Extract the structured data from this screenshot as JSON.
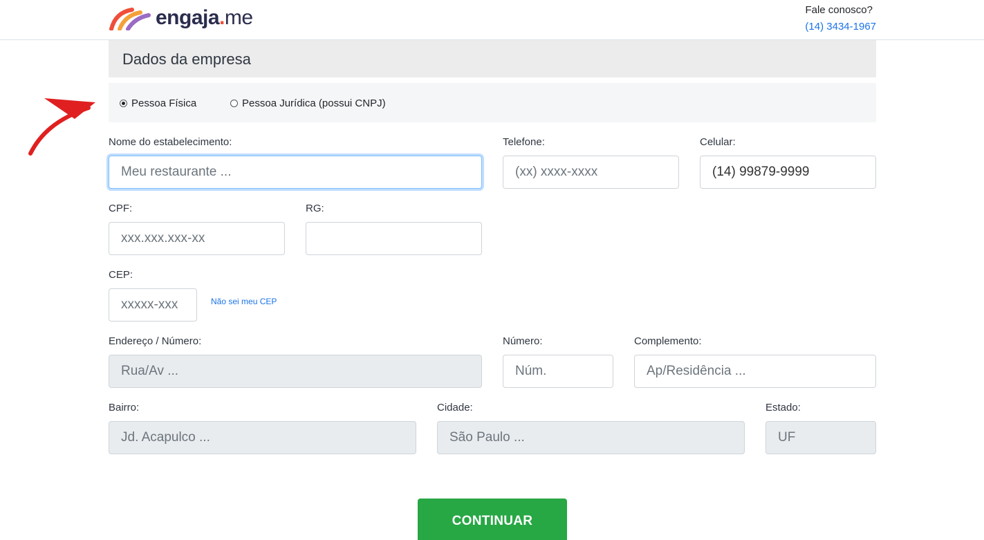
{
  "header": {
    "logo_text": "engaja",
    "logo_dot": ".",
    "logo_suffix": "me",
    "contact_label": "Fale conosco?",
    "contact_phone": "(14) 3434-1967"
  },
  "section": {
    "title": "Dados da empresa"
  },
  "person_type": {
    "options": [
      {
        "label": "Pessoa Física",
        "selected": true
      },
      {
        "label": "Pessoa Jurídica (possui CNPJ)",
        "selected": false
      }
    ]
  },
  "form": {
    "name": {
      "label": "Nome do estabelecimento:",
      "placeholder": "Meu restaurante ..."
    },
    "phone": {
      "label": "Telefone:",
      "placeholder": "(xx) xxxx-xxxx"
    },
    "cell": {
      "label": "Celular:",
      "value": "(14) 99879-9999"
    },
    "cpf": {
      "label": "CPF:",
      "placeholder": "xxx.xxx.xxx-xx"
    },
    "rg": {
      "label": "RG:",
      "placeholder": ""
    },
    "cep": {
      "label": "CEP:",
      "placeholder": "xxxxx-xxx",
      "help_link": "Não sei meu CEP"
    },
    "address": {
      "label": "Endereço / Número:",
      "placeholder": "Rua/Av ..."
    },
    "number": {
      "label": "Número:",
      "placeholder": "Núm."
    },
    "complement": {
      "label": "Complemento:",
      "placeholder": "Ap/Residência ..."
    },
    "district": {
      "label": "Bairro:",
      "placeholder": "Jd. Acapulco ..."
    },
    "city": {
      "label": "Cidade:",
      "placeholder": "São Paulo ..."
    },
    "state": {
      "label": "Estado:",
      "placeholder": "UF"
    }
  },
  "actions": {
    "continue_label": "CONTINUAR"
  },
  "colors": {
    "accent_green": "#28a745",
    "link_blue": "#1a73e8",
    "arrow_red": "#e02020"
  }
}
